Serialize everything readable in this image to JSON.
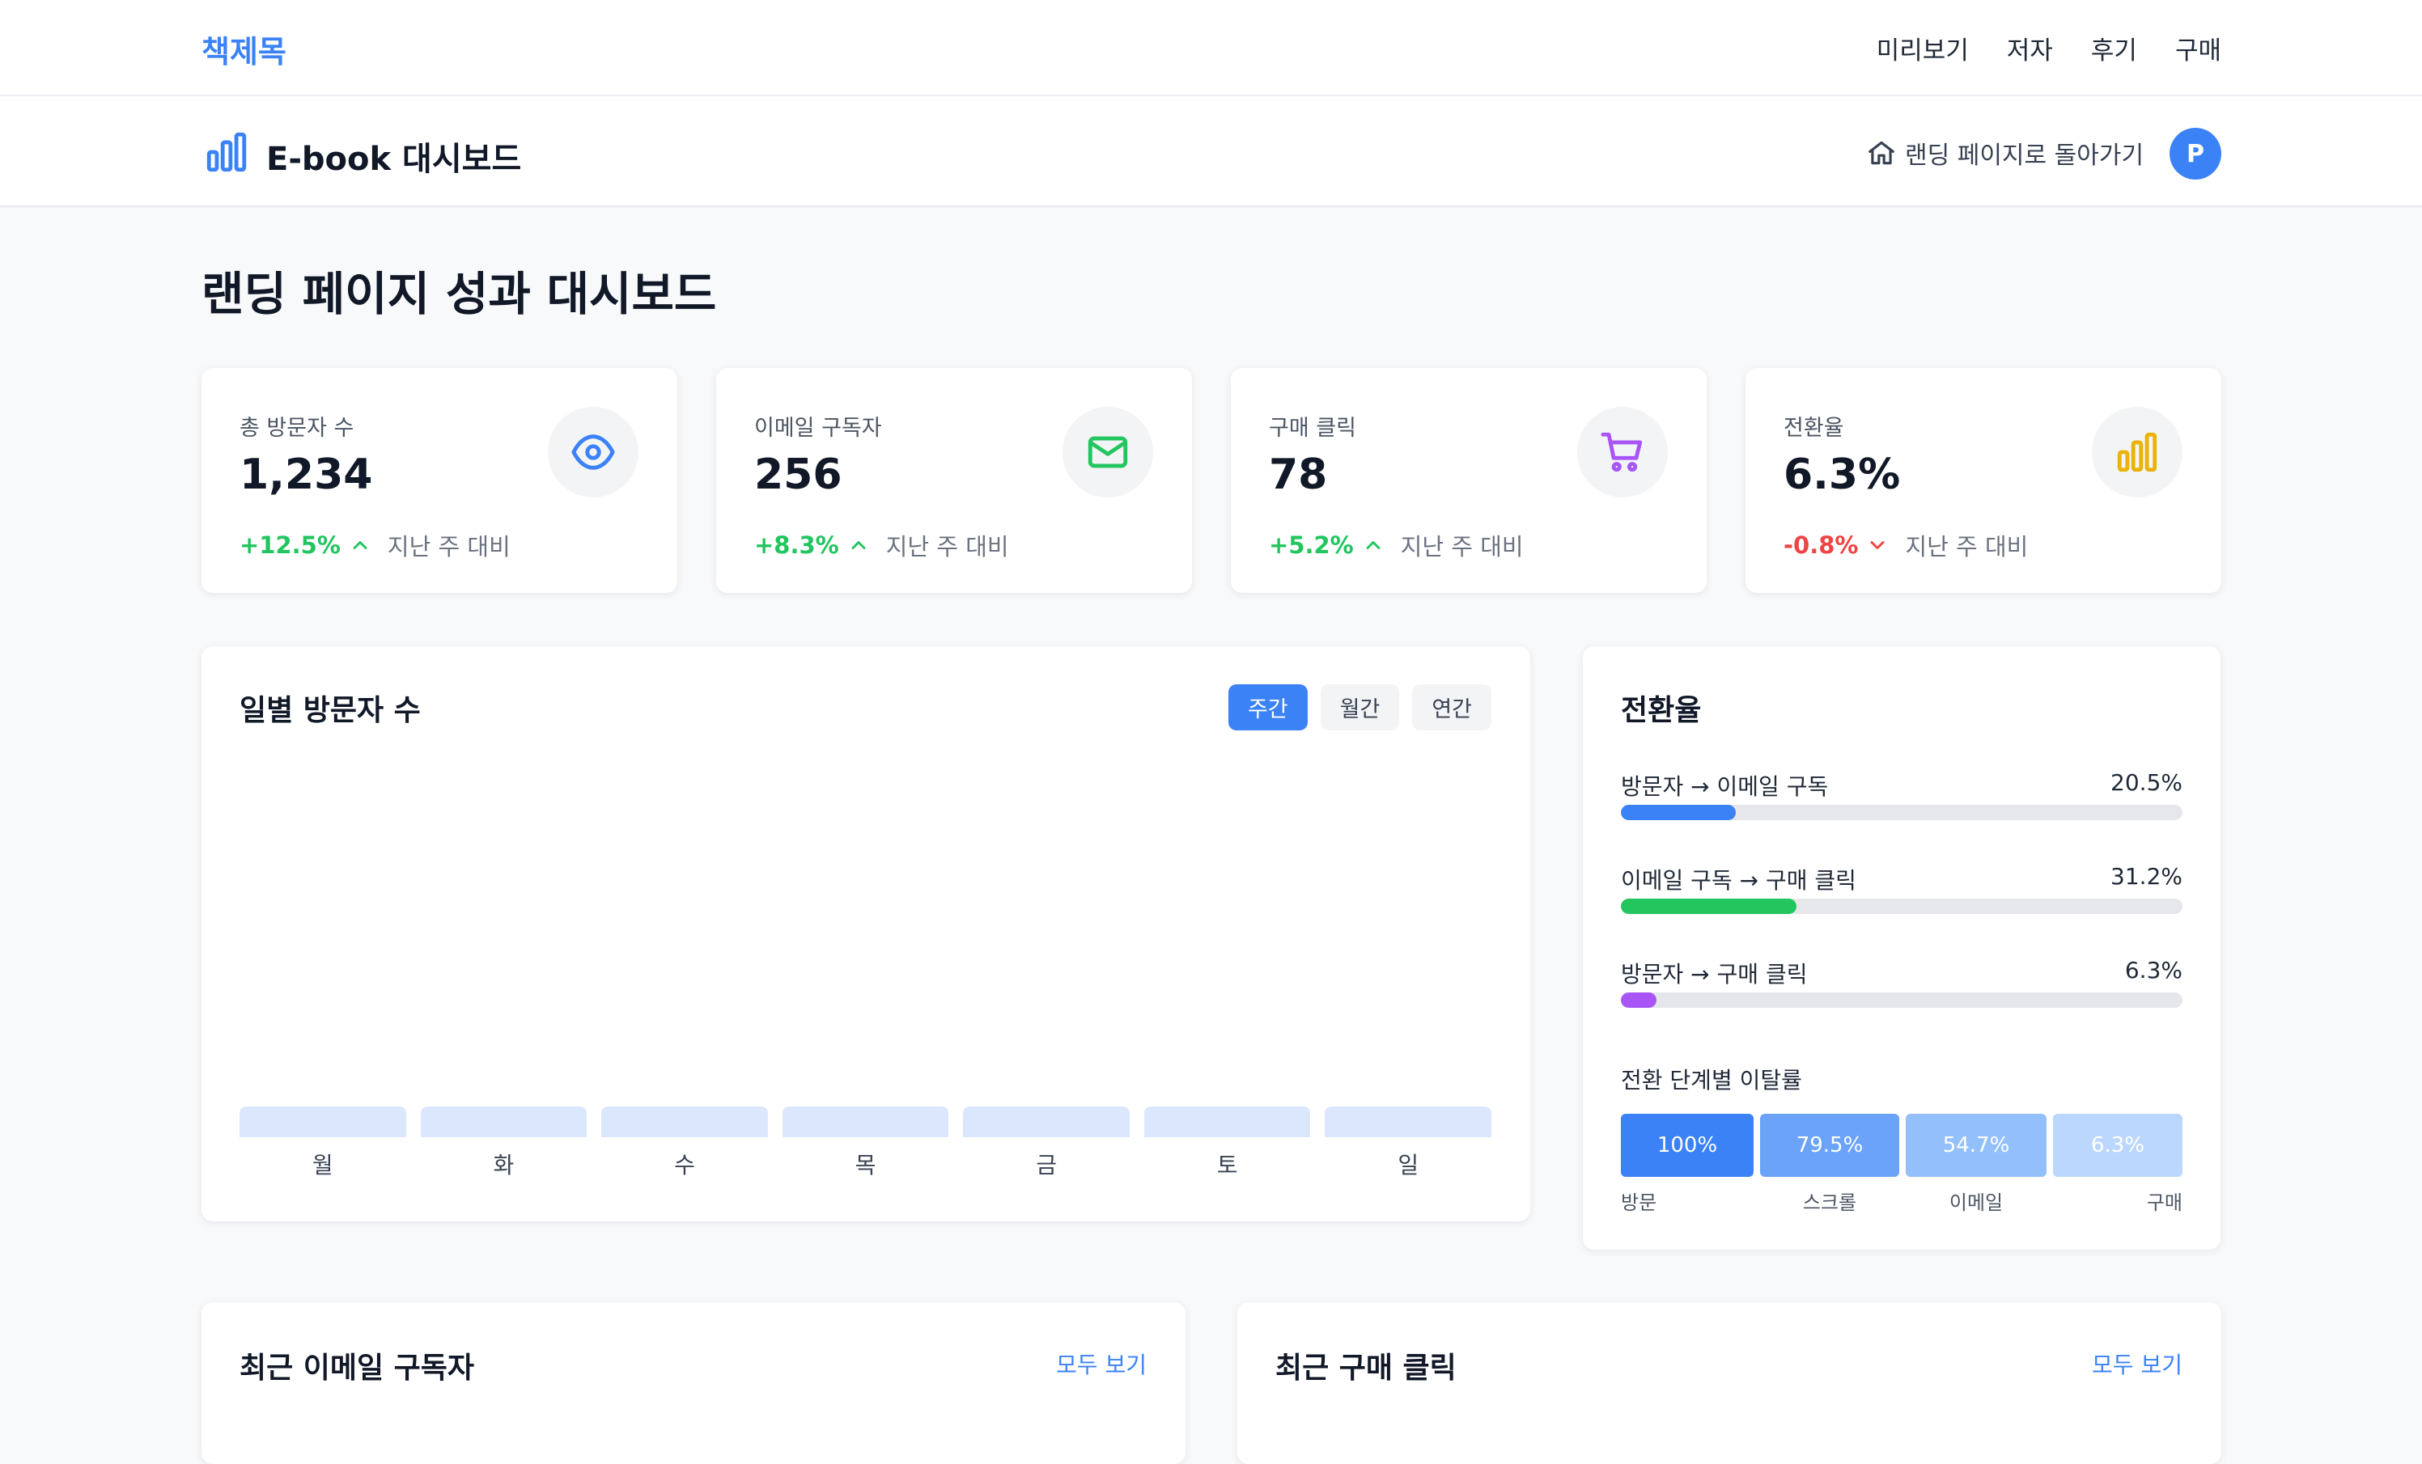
{
  "topnav": {
    "brand": "책제목",
    "links": [
      "미리보기",
      "저자",
      "후기",
      "구매"
    ]
  },
  "header": {
    "title": "E-book 대시보드",
    "back_label": "랜딩 페이지로 돌아가기",
    "avatar_initial": "P"
  },
  "page_title": "랜딩 페이지 성과 대시보드",
  "stats": [
    {
      "label": "총 방문자 수",
      "value": "1,234",
      "change": "+12.5%",
      "direction": "up",
      "compare": "지난 주 대비",
      "icon": "eye-icon",
      "color": "#3b82f6"
    },
    {
      "label": "이메일 구독자",
      "value": "256",
      "change": "+8.3%",
      "direction": "up",
      "compare": "지난 주 대비",
      "icon": "mail-icon",
      "color": "#22c55e"
    },
    {
      "label": "구매 클릭",
      "value": "78",
      "change": "+5.2%",
      "direction": "up",
      "compare": "지난 주 대비",
      "icon": "cart-icon",
      "color": "#a855f7"
    },
    {
      "label": "전환율",
      "value": "6.3%",
      "change": "-0.8%",
      "direction": "down",
      "compare": "지난 주 대비",
      "icon": "bar-chart-icon",
      "color": "#eab308"
    }
  ],
  "daily_chart": {
    "title": "일별 방문자 수",
    "ranges": [
      "주간",
      "월간",
      "연간"
    ],
    "active_range": "주간",
    "days": [
      "월",
      "화",
      "수",
      "목",
      "금",
      "토",
      "일"
    ]
  },
  "conversion": {
    "title": "전환율",
    "rates": [
      {
        "label": "방문자 → 이메일 구독",
        "value": "20.5%",
        "fraction": 0.205,
        "color": "#3b82f6"
      },
      {
        "label": "이메일 구독 → 구매 클릭",
        "value": "31.2%",
        "fraction": 0.312,
        "color": "#22c55e"
      },
      {
        "label": "방문자 → 구매 클릭",
        "value": "6.3%",
        "fraction": 0.063,
        "color": "#a855f7"
      }
    ],
    "drop_title": "전환 단계별 이탈률",
    "funnel": [
      {
        "value": "100%",
        "label": "방문",
        "color": "#3b82f6"
      },
      {
        "value": "79.5%",
        "label": "스크롤",
        "color": "#6aa3f8"
      },
      {
        "value": "54.7%",
        "label": "이메일",
        "color": "#93c0fb"
      },
      {
        "value": "6.3%",
        "label": "구매",
        "color": "#bcd7fd"
      }
    ]
  },
  "recent_subscribers": {
    "title": "최근 이메일 구독자",
    "link": "모두 보기"
  },
  "recent_purchases": {
    "title": "최근 구매 클릭",
    "link": "모두 보기"
  }
}
